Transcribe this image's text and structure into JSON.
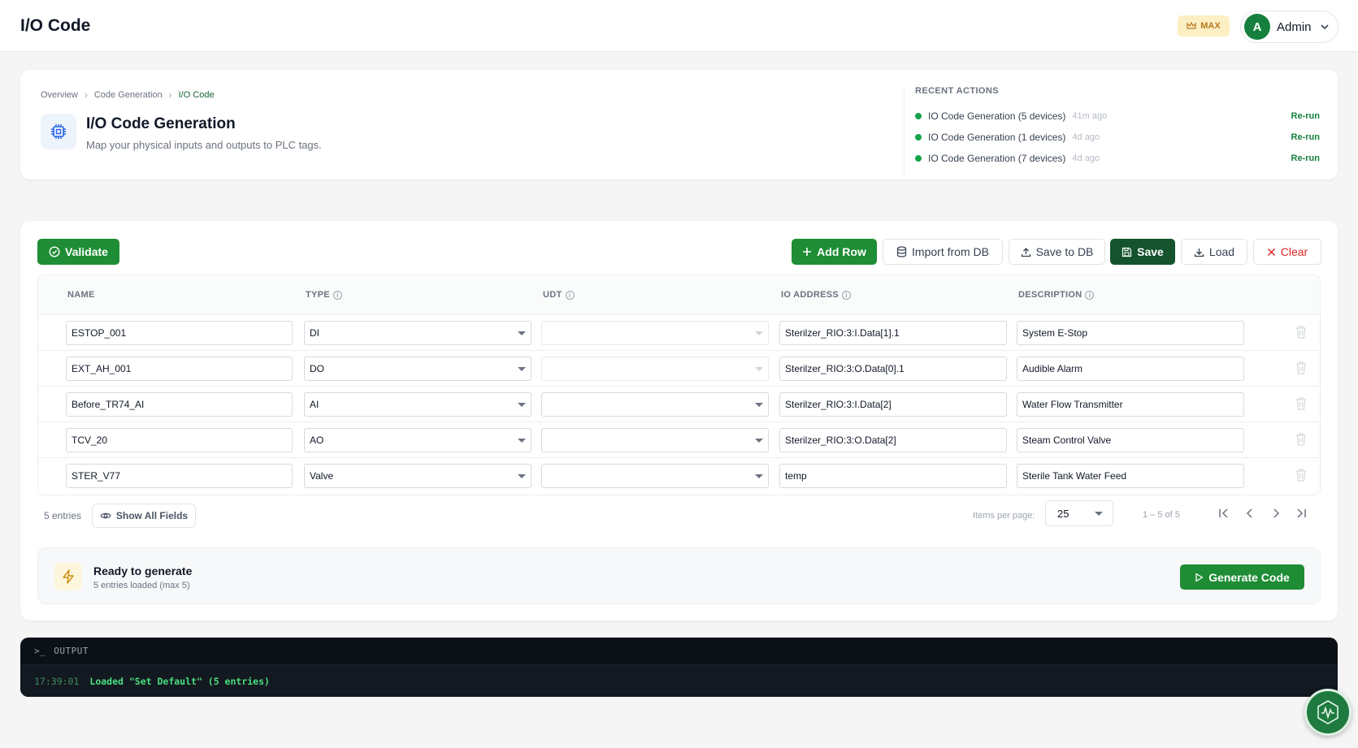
{
  "topbar": {
    "app_title": "I/O Code",
    "badge": "MAX",
    "user": {
      "initial": "A",
      "name": "Admin"
    }
  },
  "header": {
    "breadcrumb": [
      "Overview",
      "Code Generation",
      "I/O Code"
    ],
    "title": "I/O Code Generation",
    "subtitle": "Map your physical inputs and outputs to PLC tags."
  },
  "recent_actions": {
    "title": "RECENT ACTIONS",
    "rerun_label": "Re-run",
    "items": [
      {
        "label": "IO Code Generation (5 devices)",
        "time": "41m ago"
      },
      {
        "label": "IO Code Generation (1 devices)",
        "time": "4d ago"
      },
      {
        "label": "IO Code Generation (7 devices)",
        "time": "4d ago"
      }
    ]
  },
  "toolbar": {
    "validate": "Validate",
    "add_row": "Add Row",
    "import_db": "Import from DB",
    "save_db": "Save to DB",
    "save": "Save",
    "load": "Load",
    "clear": "Clear"
  },
  "table": {
    "columns": [
      "NAME",
      "TYPE",
      "UDT",
      "IO ADDRESS",
      "DESCRIPTION"
    ],
    "rows": [
      {
        "name": "ESTOP_001",
        "type": "DI",
        "udt": "",
        "address": "Sterilzer_RIO:3:I.Data[1].1",
        "description": "System E-Stop"
      },
      {
        "name": "EXT_AH_001",
        "type": "DO",
        "udt": "",
        "address": "Sterilzer_RIO:3:O.Data[0].1",
        "description": "Audible Alarm"
      },
      {
        "name": "Before_TR74_AI",
        "type": "AI",
        "udt": "",
        "address": "Sterilzer_RIO:3:I.Data[2]",
        "description": "Water Flow Transmitter"
      },
      {
        "name": "TCV_20",
        "type": "AO",
        "udt": "",
        "address": "Sterilzer_RIO:3:O.Data[2]",
        "description": "Steam Control Valve"
      },
      {
        "name": "STER_V77",
        "type": "Valve",
        "udt": "",
        "address": "temp",
        "description": "Sterile Tank Water Feed"
      }
    ]
  },
  "footer": {
    "entries": "5 entries",
    "show_all": "Show All Fields",
    "items_per_page_label": "Items per page:",
    "items_per_page": "25",
    "range": "1 – 5 of 5"
  },
  "generate": {
    "title": "Ready to generate",
    "subtitle": "5 entries loaded (max 5)",
    "button": "Generate Code"
  },
  "output": {
    "prompt": ">_",
    "title": "OUTPUT",
    "lines": [
      {
        "time": "17:39:01",
        "message": "Loaded \"Set Default\" (5 entries)"
      }
    ]
  },
  "colors": {
    "accent": "#1e8d35",
    "dark_accent": "#14532d",
    "danger": "#dc2626"
  }
}
